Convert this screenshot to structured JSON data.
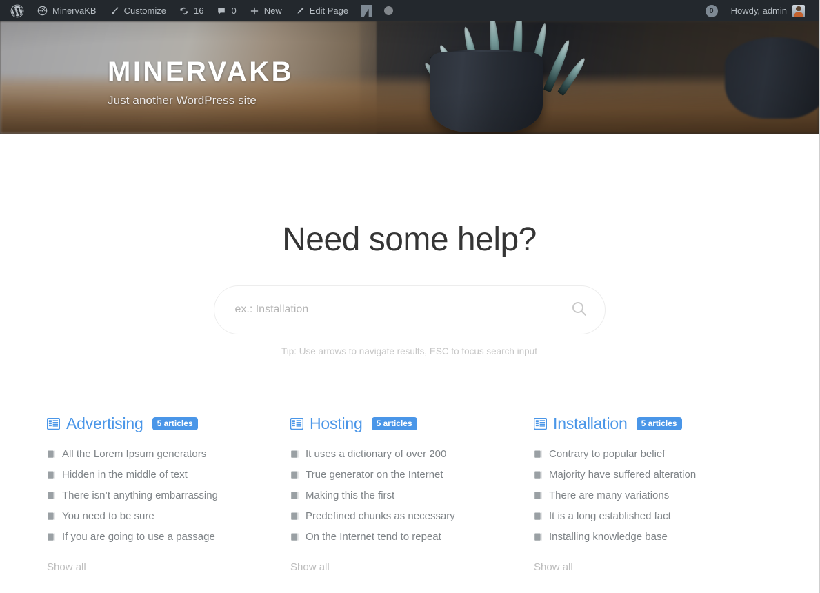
{
  "adminbar": {
    "wp_logo": "wordpress-logo",
    "site_name": "MinervaKB",
    "customize": "Customize",
    "updates_count": "16",
    "comments_count": "0",
    "new": "New",
    "edit_page": "Edit Page",
    "notifications_count": "0",
    "howdy": "Howdy, admin",
    "bg_color": "#23282d",
    "text_color": "#b5bcc2"
  },
  "hero": {
    "title": "MINERVAKB",
    "tagline": "Just another WordPress site"
  },
  "search": {
    "heading": "Need some help?",
    "placeholder": "ex.: Installation",
    "value": "",
    "tip": "Tip: Use arrows to navigate results, ESC to focus search input"
  },
  "accent_color": "#4a96e8",
  "categories": [
    {
      "name": "Advertising",
      "badge": "5 articles",
      "show_all": "Show all",
      "articles": [
        "All the Lorem Ipsum generators",
        "Hidden in the middle of text",
        "There isn’t anything embarrassing",
        "You need to be sure",
        "If you are going to use a passage"
      ]
    },
    {
      "name": "Hosting",
      "badge": "5 articles",
      "show_all": "Show all",
      "articles": [
        "It uses a dictionary of over 200",
        "True generator on the Internet",
        "Making this the first",
        "Predefined chunks as necessary",
        "On the Internet tend to repeat"
      ]
    },
    {
      "name": "Installation",
      "badge": "5 articles",
      "show_all": "Show all",
      "articles": [
        "Contrary to popular belief",
        "Majority have suffered alteration",
        "There are many variations",
        "It is a long established fact",
        "Installing knowledge base"
      ]
    }
  ]
}
